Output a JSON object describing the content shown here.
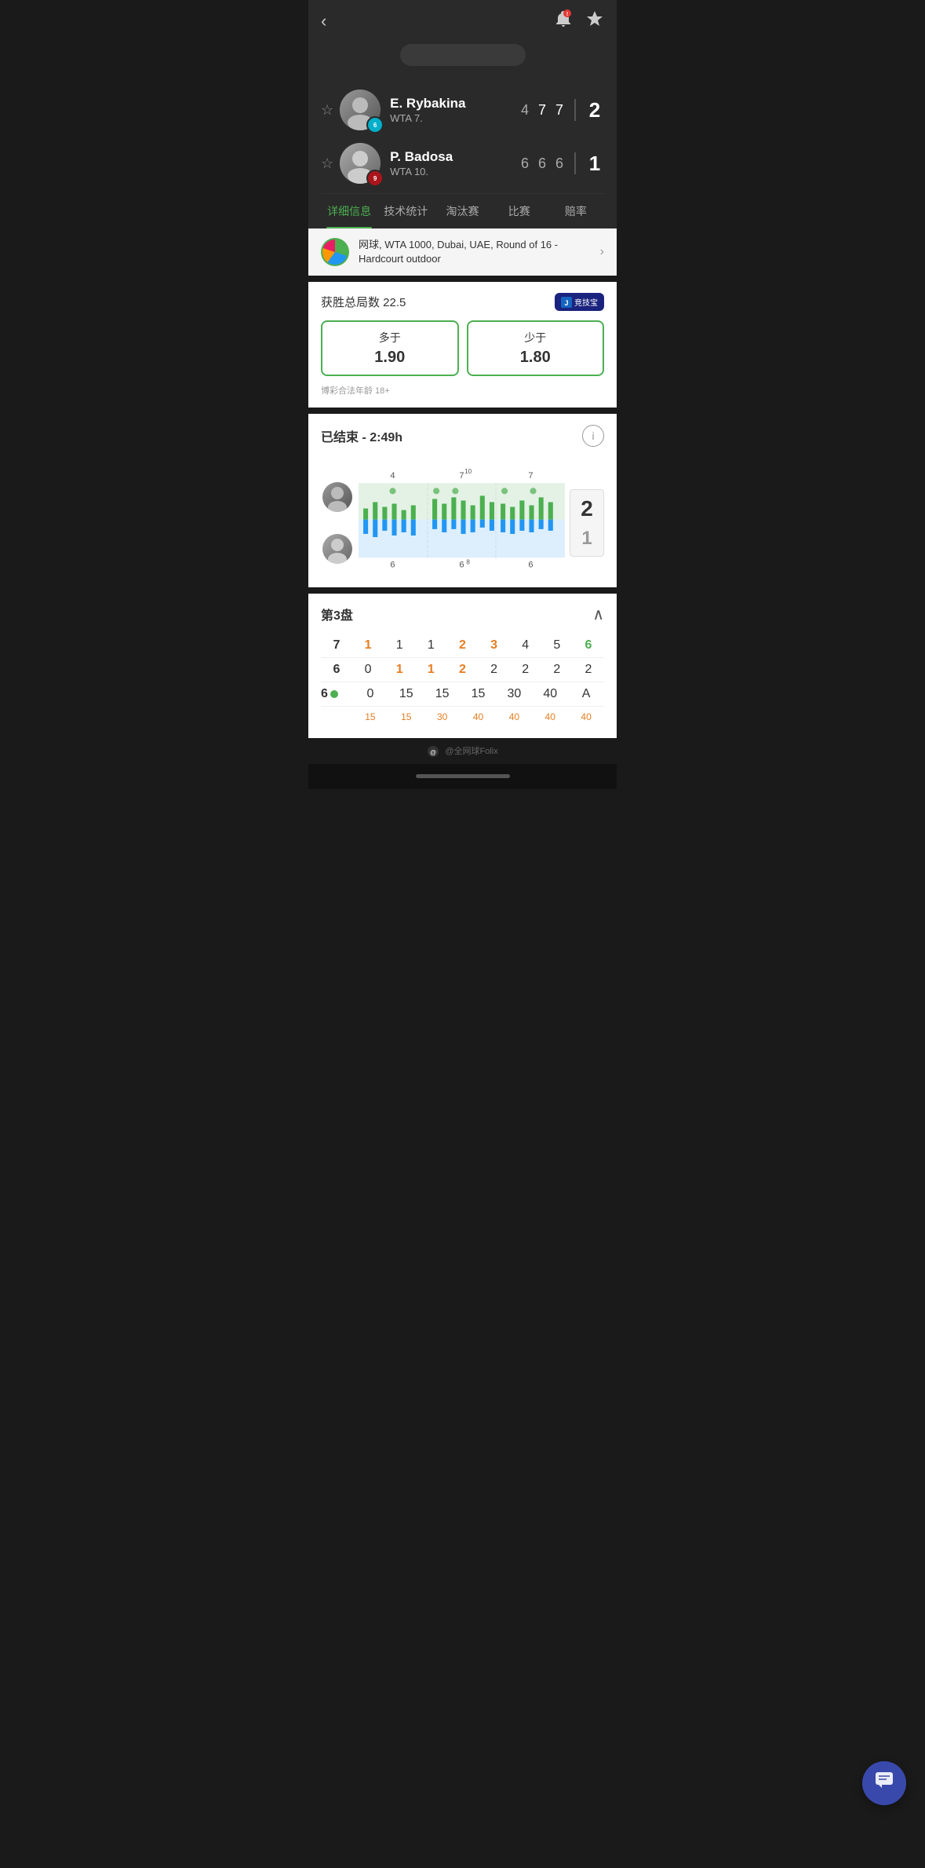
{
  "header": {
    "back_label": "‹",
    "bell_label": "🔔",
    "star_label": "☆"
  },
  "players": [
    {
      "name": "E. Rybakina",
      "rank": "WTA 7.",
      "flag": "KAZ",
      "flag_num": "6",
      "set_scores": [
        "4",
        "7",
        "7"
      ],
      "final_score": "2",
      "avatar_color": "#888"
    },
    {
      "name": "P. Badosa",
      "rank": "WTA 10.",
      "flag": "ESP",
      "flag_num": "9",
      "set_scores": [
        "6",
        "6",
        "6"
      ],
      "final_score": "1",
      "avatar_color": "#777"
    }
  ],
  "tabs": [
    {
      "label": "详细信息",
      "active": true
    },
    {
      "label": "技术统计",
      "active": false
    },
    {
      "label": "淘汰赛",
      "active": false
    },
    {
      "label": "比赛",
      "active": false
    },
    {
      "label": "赔率",
      "active": false
    }
  ],
  "tournament": {
    "text": "网球, WTA 1000, Dubai, UAE, Round of 16 - Hardcourt outdoor"
  },
  "betting": {
    "title": "获胜总局数 22.5",
    "over_label": "多于",
    "over_odds": "1.90",
    "under_label": "少于",
    "under_odds": "1.80",
    "disclaimer": "博彩合法年龄 18+",
    "logo_text": "竞技宝"
  },
  "chart": {
    "title": "已结束 - 2:49h",
    "set1_top": "4",
    "set2_top": "7",
    "set2_top_sup": "10",
    "set3_top": "7",
    "set1_bottom": "6",
    "set2_bottom": "6",
    "set2_bottom_sub": "8",
    "set3_bottom": "6",
    "winner_scores": [
      "2",
      "1"
    ]
  },
  "score_table": {
    "title": "第3盘",
    "rows": [
      {
        "player": "7",
        "cells": [
          "1",
          "1",
          "1",
          "2",
          "3",
          "4",
          "5",
          "6"
        ],
        "highlights": [
          0,
          3,
          4,
          7
        ]
      },
      {
        "player": "6",
        "cells": [
          "0",
          "1",
          "1",
          "2",
          "2",
          "2",
          "2",
          "2"
        ],
        "highlights": [
          1,
          3
        ]
      }
    ],
    "row2": {
      "player": "6",
      "dot": true,
      "cells": [
        "0",
        "15",
        "15",
        "15",
        "30",
        "40",
        "A"
      ],
      "sub_cells": [
        "15",
        "15",
        "30",
        "40",
        "40",
        "40",
        "40"
      ],
      "highlights": [
        1,
        2,
        3,
        4
      ]
    }
  },
  "watermark": "@全网球Folix"
}
